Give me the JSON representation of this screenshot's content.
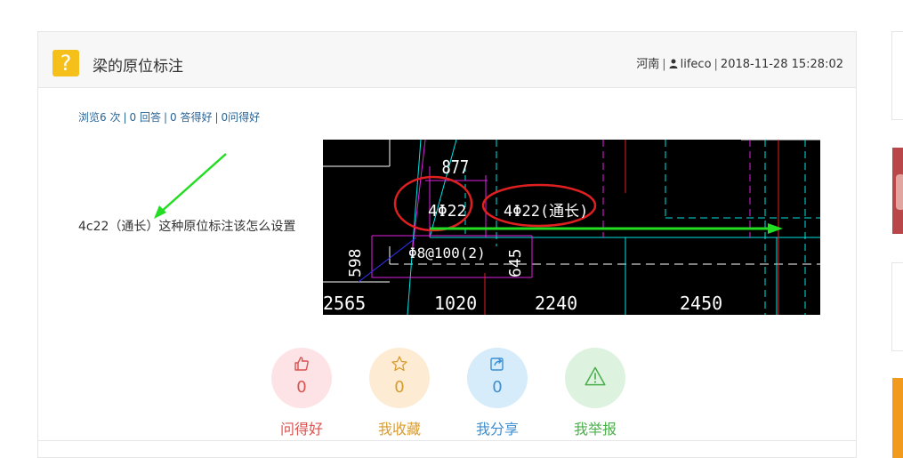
{
  "question": {
    "title": "梁的原位标注",
    "region": "河南",
    "user": "lifeco",
    "datetime": "2018-11-28 15:28:02",
    "stats": {
      "views": "浏览6 次",
      "answers": "0 回答",
      "good_answers": "0 答得好",
      "good_asks": "0问得好"
    },
    "body_text": "4c22（通长）这种原位标注该怎么设置"
  },
  "cad_image": {
    "labels": {
      "dim_877": "877",
      "rebar_left": "4Φ22",
      "rebar_right": "4Φ22(通长)",
      "stirrup": "Φ8@100(2)",
      "dim_598": "598",
      "dim_645": "645",
      "span_2565": "2565",
      "span_1020": "1020",
      "span_2240": "2240",
      "span_2450": "2450"
    }
  },
  "actions": [
    {
      "icon": "thumbs-up-icon",
      "count": "0",
      "label": "问得好",
      "color": "#d9534f"
    },
    {
      "icon": "star-icon",
      "count": "0",
      "label": "我收藏",
      "color": "#d89b2f"
    },
    {
      "icon": "share-icon",
      "count": "0",
      "label": "我分享",
      "color": "#3d8fd1"
    },
    {
      "icon": "warning-icon",
      "count": "0",
      "label": "我举报",
      "color": "#4cae4c"
    }
  ],
  "colors": {
    "question_icon": "#f5c01a",
    "link": "#2a6496"
  }
}
